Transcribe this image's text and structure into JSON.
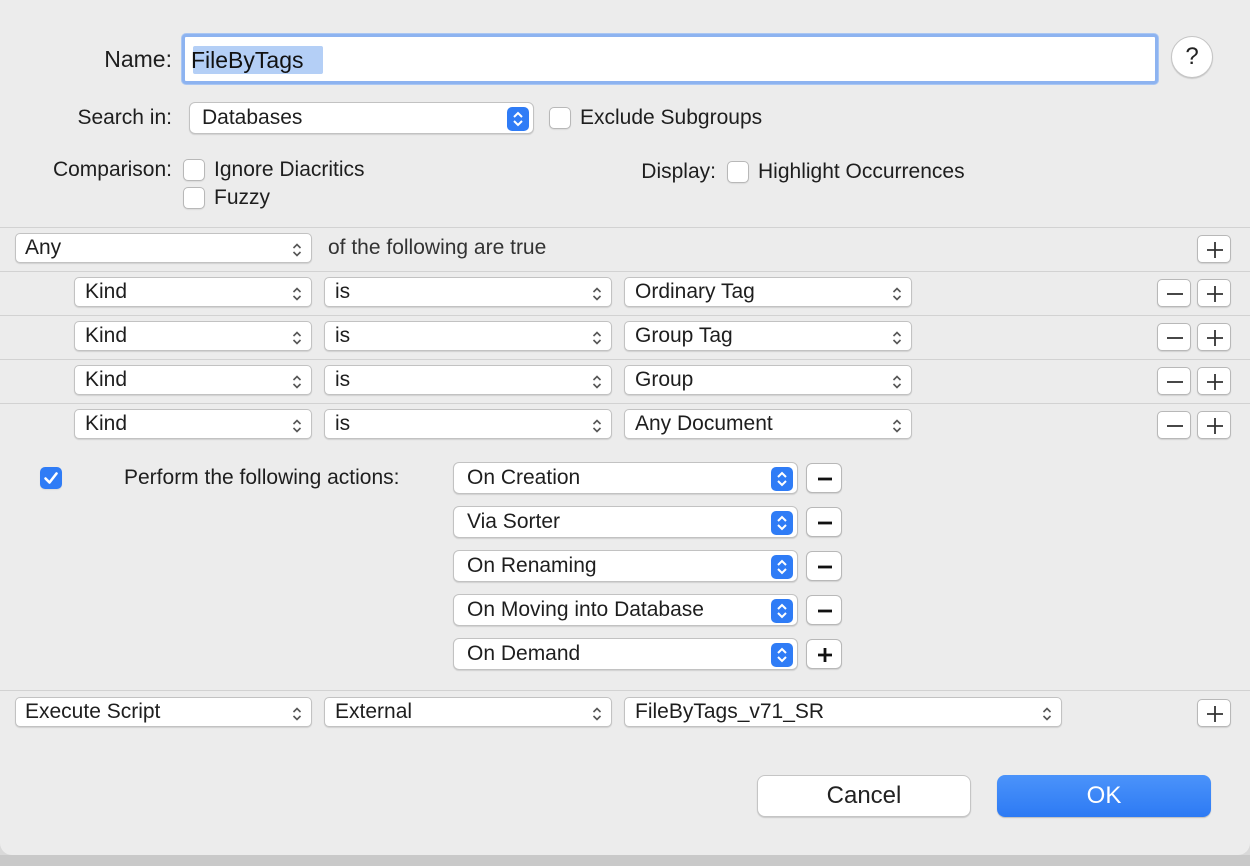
{
  "form": {
    "name_label": "Name:",
    "name_value": "FileByTags",
    "help_label": "?",
    "search_in_label": "Search in:",
    "search_in_value": "Databases",
    "exclude_subgroups_label": "Exclude Subgroups",
    "exclude_subgroups_checked": false,
    "comparison_label": "Comparison:",
    "ignore_diacritics_label": "Ignore Diacritics",
    "ignore_diacritics_checked": false,
    "fuzzy_label": "Fuzzy",
    "fuzzy_checked": false,
    "display_label": "Display:",
    "highlight_label": "Highlight Occurrences",
    "highlight_checked": false
  },
  "criteria": {
    "match_value": "Any",
    "match_suffix": "of the following are true",
    "rows": [
      {
        "field": "Kind",
        "operator": "is",
        "value": "Ordinary Tag"
      },
      {
        "field": "Kind",
        "operator": "is",
        "value": "Group Tag"
      },
      {
        "field": "Kind",
        "operator": "is",
        "value": "Group"
      },
      {
        "field": "Kind",
        "operator": "is",
        "value": "Any Document"
      }
    ]
  },
  "actions": {
    "enabled": true,
    "label": "Perform the following actions:",
    "triggers": [
      {
        "value": "On Creation",
        "button": "remove"
      },
      {
        "value": "Via Sorter",
        "button": "remove"
      },
      {
        "value": "On Renaming",
        "button": "remove"
      },
      {
        "value": "On Moving into Database",
        "button": "remove"
      },
      {
        "value": "On Demand",
        "button": "add"
      }
    ]
  },
  "script": {
    "action": "Execute Script",
    "source": "External",
    "file": "FileByTags_v71_SR"
  },
  "buttons": {
    "cancel": "Cancel",
    "ok": "OK"
  },
  "colors": {
    "accent": "#2f7cf6",
    "selection": "#b4cff6"
  }
}
